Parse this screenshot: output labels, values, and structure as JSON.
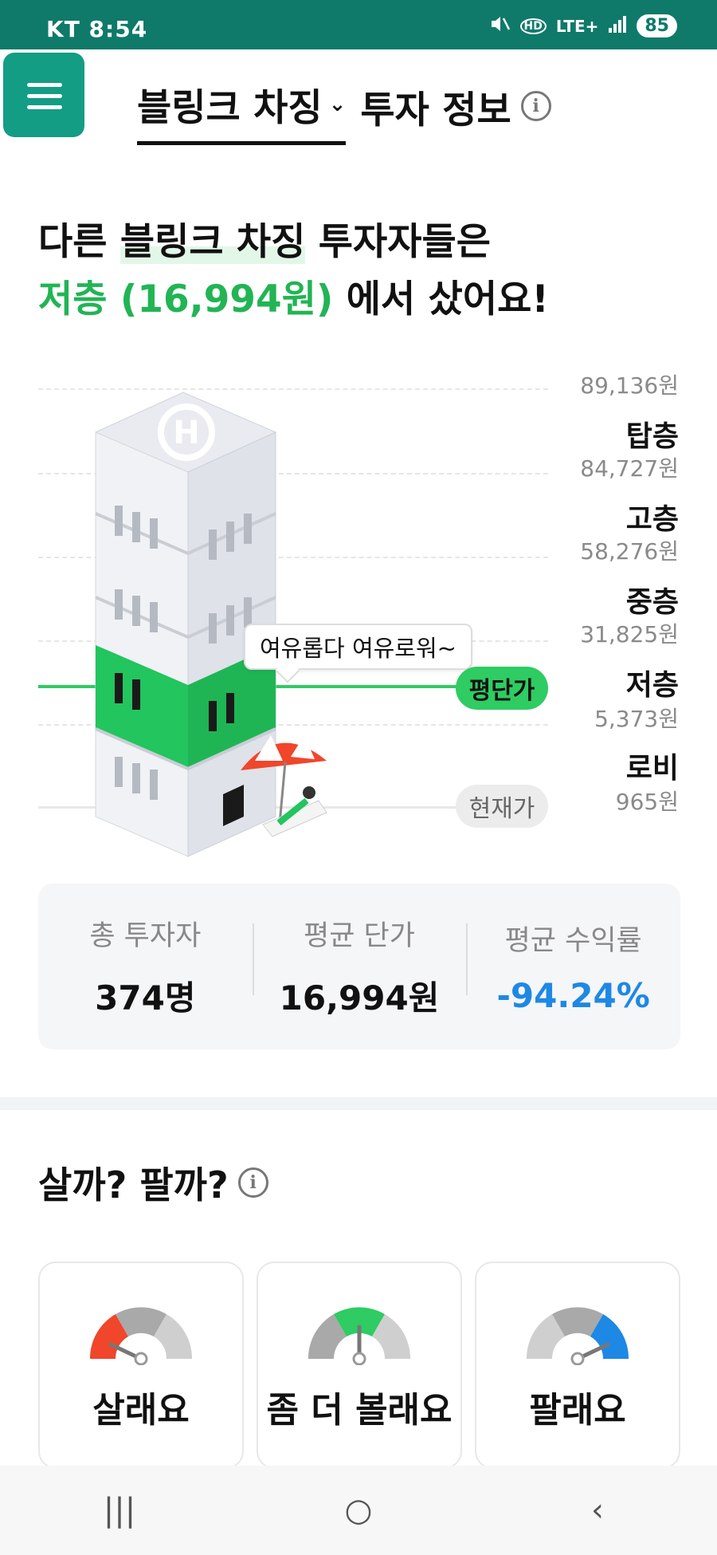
{
  "status_bar": {
    "carrier_time": "KT 8:54",
    "icons": [
      "mute-icon",
      "hd-icon",
      "lte-icon",
      "signal-icon"
    ],
    "lte": "LTE+",
    "battery": "85"
  },
  "header": {
    "stock_name": "블링크 차징",
    "chevron": "⌄",
    "suffix": "투자 정보",
    "info": "i"
  },
  "headline": {
    "line1_prefix": "다른 ",
    "line1_stock": "블링크 차징",
    "line1_suffix": " 투자자들은",
    "line2_floor": "저층 (16,994원)",
    "line2_suffix": " 에서 샀어요!"
  },
  "building": {
    "bubble": "여유롭다 여유로워~",
    "average_pill": "평단가",
    "current_pill": "현재가",
    "floors": [
      {
        "name": "탑층",
        "price_top": "89,136원",
        "price_bottom": "84,727원"
      },
      {
        "name": "고층",
        "price_bottom": "58,276원"
      },
      {
        "name": "중층",
        "price_bottom": "31,825원"
      },
      {
        "name": "저층",
        "price_bottom": "5,373원"
      },
      {
        "name": "로비",
        "price_bottom": "965원"
      }
    ],
    "highlight_color": "#22c55e"
  },
  "stats": [
    {
      "label": "총 투자자",
      "value": "374명"
    },
    {
      "label": "평균 단가",
      "value": "16,994원"
    },
    {
      "label": "평균 수익률",
      "value": "-94.24%"
    }
  ],
  "sentiment": {
    "title": "살까? 팔까?",
    "info": "i",
    "cards": [
      {
        "label": "살래요",
        "color": "#f0462c"
      },
      {
        "label": "좀 더 볼래요",
        "color": "#2ecc62"
      },
      {
        "label": "팔래요",
        "color": "#1e88e5"
      }
    ]
  },
  "nav": {
    "recent": "|||",
    "home": "○",
    "back": "‹"
  }
}
